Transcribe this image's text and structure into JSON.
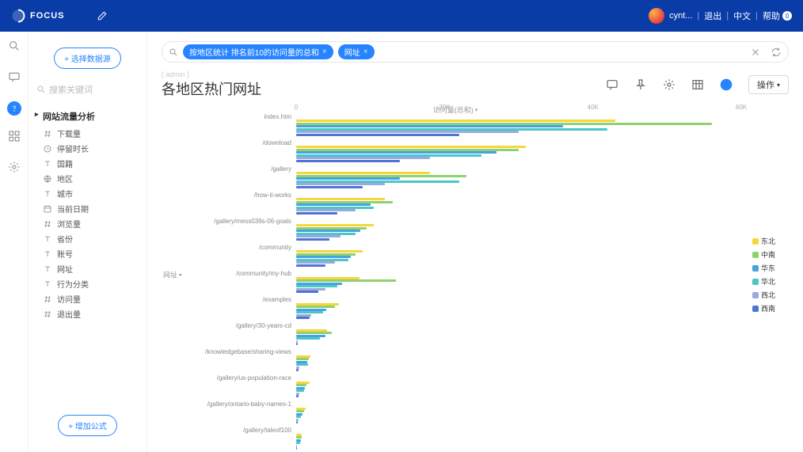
{
  "header": {
    "brand": "FOCUS",
    "username": "cynt...",
    "logout": "退出",
    "lang": "中文",
    "help": "帮助",
    "help_badge": "0"
  },
  "sidebar": {
    "select_datasource": "+ 选择数据源",
    "search_placeholder": "搜索关键词",
    "group_title": "网站流量分析",
    "fields": [
      "下载量",
      "停留时长",
      "国籍",
      "地区",
      "城市",
      "当前日期",
      "浏览量",
      "省份",
      "账号",
      "网址",
      "行为分类",
      "访问量",
      "退出量"
    ],
    "add_formula": "+ 增加公式"
  },
  "search": {
    "pill1": "按地区统计 排名前10的访问量的总和",
    "pill2": "网址"
  },
  "title": {
    "sup": "[ admin ]",
    "main": "各地区热门网址",
    "op": "操作"
  },
  "chart_data": {
    "type": "bar",
    "orientation": "horizontal",
    "xlabel": "访问量(总和)",
    "ylabel": "网址",
    "xlim": [
      0,
      60000
    ],
    "xticks": [
      0,
      20000,
      40000,
      60000
    ],
    "xtick_labels": [
      "0",
      "20K",
      "40K",
      "60K"
    ],
    "categories": [
      "index.htm",
      "/download",
      "/gallery",
      "/how-it-works",
      "/gallery/mess039s-06-goals",
      "/community",
      "/community/my-hub",
      "/examples",
      "/gallery/30-years-cd",
      "/knowledgebase/sharing-views",
      "/gallery/us-population-race",
      "/gallery/ontario-baby-names-1",
      "/gallery/taleof100"
    ],
    "series": [
      {
        "name": "东北",
        "color": "#f5d63d",
        "values": [
          43000,
          31000,
          18000,
          12000,
          10500,
          9000,
          8500,
          5800,
          4200,
          1900,
          1800,
          1300,
          800
        ]
      },
      {
        "name": "中南",
        "color": "#8fd16f",
        "values": [
          56000,
          30000,
          23000,
          13000,
          9500,
          8000,
          13500,
          5200,
          4800,
          1700,
          1400,
          1100,
          700
        ]
      },
      {
        "name": "华东",
        "color": "#46a3e0",
        "values": [
          36000,
          27000,
          14000,
          10000,
          8700,
          7400,
          6200,
          4100,
          4000,
          1500,
          1200,
          900,
          600
        ]
      },
      {
        "name": "华北",
        "color": "#4bc6c9",
        "values": [
          42000,
          25000,
          22000,
          10500,
          8000,
          7000,
          5500,
          3600,
          3200,
          1600,
          1100,
          600,
          500
        ]
      },
      {
        "name": "西北",
        "color": "#9aa9e0",
        "values": [
          30000,
          18000,
          12000,
          8000,
          6000,
          5200,
          4000,
          2000,
          200,
          400,
          400,
          300,
          100
        ]
      },
      {
        "name": "西南",
        "color": "#4f74d1",
        "values": [
          22000,
          14000,
          9000,
          5500,
          4500,
          4000,
          3000,
          1800,
          200,
          300,
          300,
          200,
          100
        ]
      }
    ]
  }
}
